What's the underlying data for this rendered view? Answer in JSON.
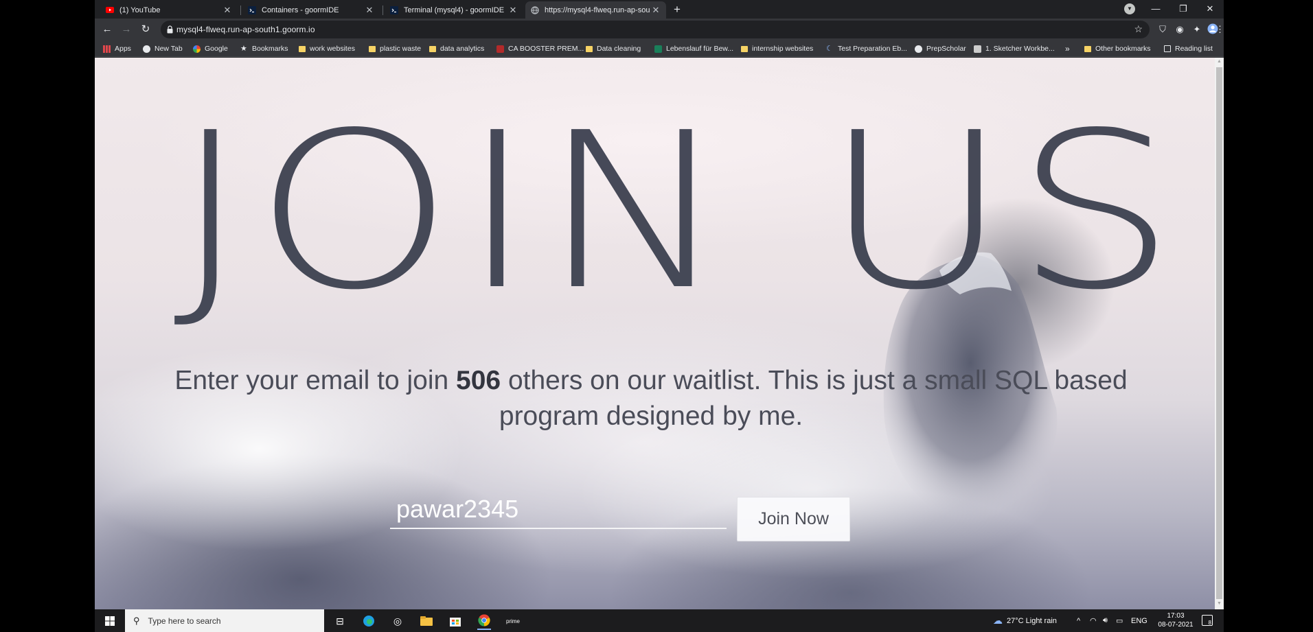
{
  "tabs": [
    {
      "title": "(1) YouTube",
      "favicon": "youtube-icon"
    },
    {
      "title": "Containers - goormIDE",
      "favicon": "terminal-icon"
    },
    {
      "title": "Terminal (mysql4) - goormIDE",
      "favicon": "terminal-icon"
    },
    {
      "title": "https://mysql4-flweq.run-ap-sou",
      "favicon": "globe-icon"
    }
  ],
  "address_bar": {
    "url": "mysql4-flweq.run-ap-south1.goorm.io"
  },
  "bookmarks": [
    {
      "label": "Apps",
      "icon": "apps-grid-icon"
    },
    {
      "label": "New Tab",
      "icon": "globe-icon"
    },
    {
      "label": "Google",
      "icon": "google-icon"
    },
    {
      "label": "Bookmarks",
      "icon": "star-icon"
    },
    {
      "label": "work websites",
      "icon": "folder-icon"
    },
    {
      "label": "plastic waste",
      "icon": "folder-icon"
    },
    {
      "label": "data analytics",
      "icon": "folder-icon"
    },
    {
      "label": "CA BOOSTER PREM...",
      "icon": "booster-icon"
    },
    {
      "label": "Data cleaning",
      "icon": "folder-icon"
    },
    {
      "label": "Lebenslauf für Bew...",
      "icon": "green-icon"
    },
    {
      "label": "internship websites",
      "icon": "folder-icon"
    },
    {
      "label": "Test Preparation Eb...",
      "icon": "moon-icon"
    },
    {
      "label": "PrepScholar",
      "icon": "prepscholar-icon"
    },
    {
      "label": "1. Sketcher Workbe...",
      "icon": "sketcher-icon"
    }
  ],
  "bookmarks_overflow": "»",
  "other_bookmarks": "Other bookmarks",
  "reading_list": "Reading list",
  "page": {
    "title": "JOIN US",
    "tagline_before": "Enter your email to join ",
    "tagline_count": "506",
    "tagline_after": " others on our waitlist. This is just a small SQL based program designed by me.",
    "email_value": "pawar2345",
    "button_label": "Join Now"
  },
  "taskbar": {
    "search_placeholder": "Type here to search",
    "weather": "27°C  Light rain",
    "language": "ENG",
    "time": "17:03",
    "date": "08-07-2021",
    "notifications": "8"
  },
  "colors": {
    "title_text": "#3d4150",
    "browser_chrome": "#202124",
    "toolbar": "#35363a"
  }
}
